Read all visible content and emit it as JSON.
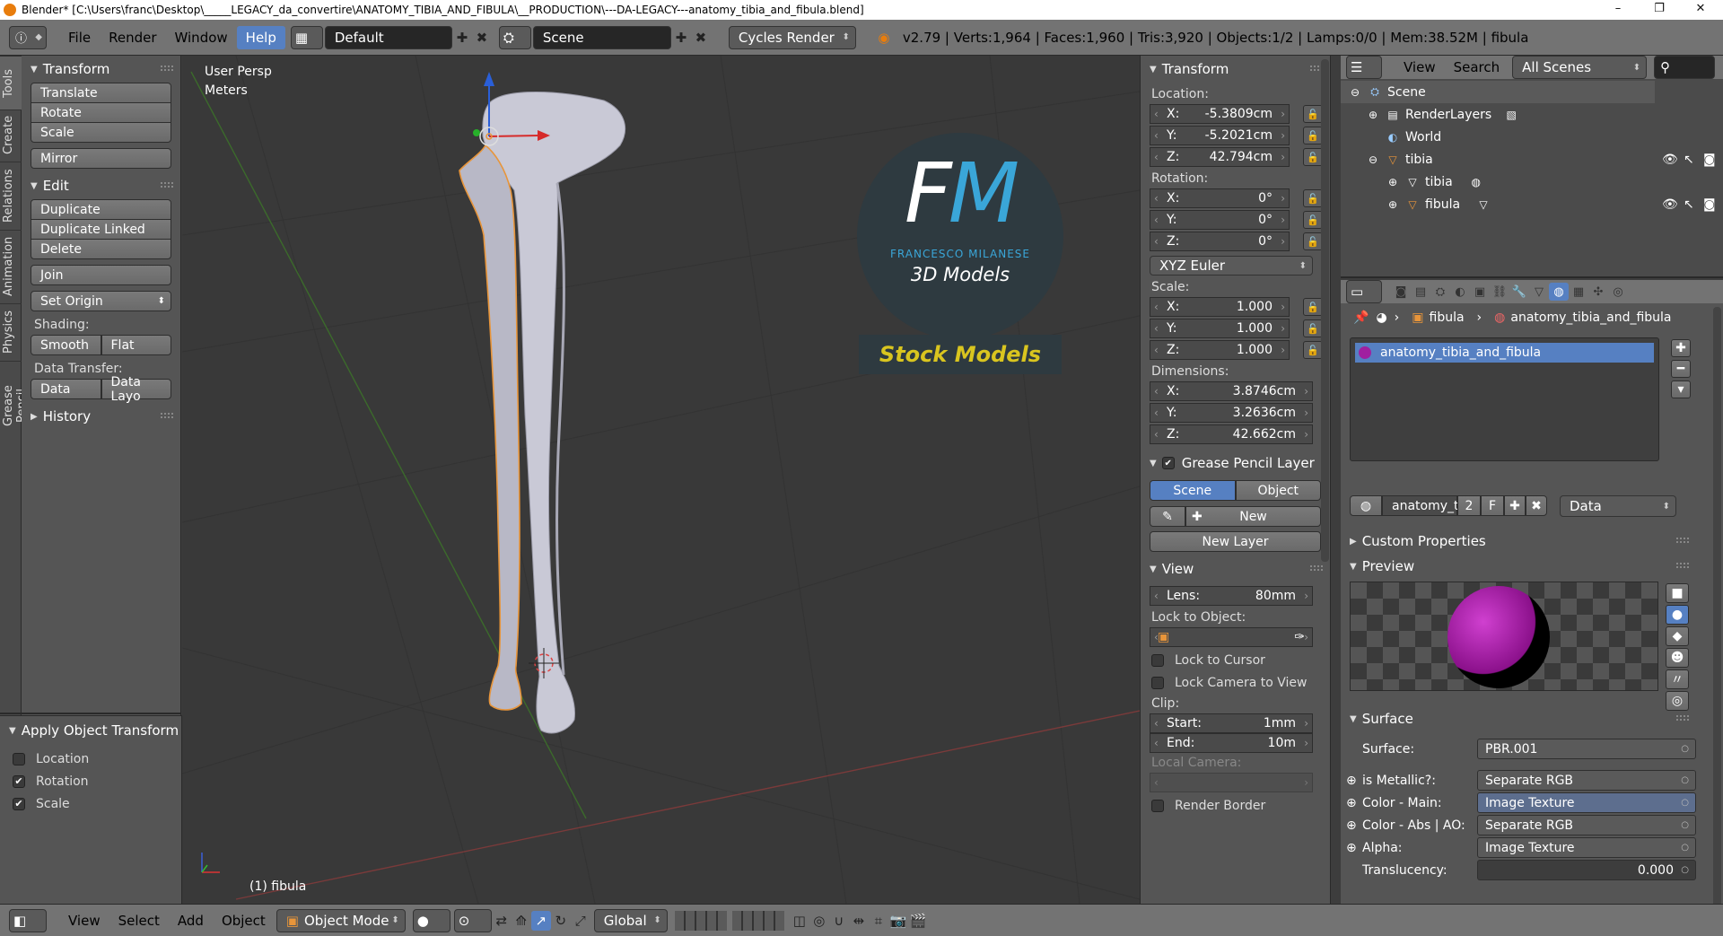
{
  "window": {
    "title": "Blender* [C:\\Users\\franc\\Desktop\\_____LEGACY_da_convertire\\ANATOMY_TIBIA_AND_FIBULA\\__PRODUCTION\\---DA-LEGACY---anatomy_tibia_and_fibula.blend]",
    "minimize": "–",
    "maximize": "❐",
    "close": "✕"
  },
  "topbar": {
    "menus": [
      "File",
      "Render",
      "Window",
      "Help"
    ],
    "active_menu": "Help",
    "layout": "Default",
    "scene": "Scene",
    "engine": "Cycles Render",
    "stats": "v2.79 | Verts:1,964 | Faces:1,960 | Tris:3,920 | Objects:1/2 | Lamps:0/0 | Mem:38.52M | fibula"
  },
  "tabs": [
    "Tools",
    "Create",
    "Relations",
    "Animation",
    "Physics",
    "Grease Pencil"
  ],
  "toolshelf": {
    "transform": {
      "title": "Transform",
      "buttons": [
        "Translate",
        "Rotate",
        "Scale"
      ],
      "mirror": "Mirror"
    },
    "edit": {
      "title": "Edit",
      "buttons": [
        "Duplicate",
        "Duplicate Linked",
        "Delete"
      ],
      "join": "Join",
      "set_origin": "Set Origin",
      "shading_label": "Shading:",
      "smooth": "Smooth",
      "flat": "Flat",
      "data_transfer_label": "Data Transfer:",
      "data": "Data",
      "data_layout": "Data Layo"
    },
    "history": "History",
    "apply": {
      "title": "Apply Object Transform",
      "location": "Location",
      "rotation": "Rotation",
      "scale": "Scale"
    }
  },
  "viewport": {
    "view_name": "User Persp",
    "units": "Meters",
    "object_label": "(1) fibula",
    "logo": {
      "letters": "FM",
      "name": "FRANCESCO MILANESE",
      "line2": "3D Models",
      "line3": "Stock Models"
    }
  },
  "npanel": {
    "transform_title": "Transform",
    "location_label": "Location:",
    "location": [
      {
        "k": "X:",
        "v": "-5.3809cm"
      },
      {
        "k": "Y:",
        "v": "-5.2021cm"
      },
      {
        "k": "Z:",
        "v": "42.794cm"
      }
    ],
    "rotation_label": "Rotation:",
    "rotation": [
      {
        "k": "X:",
        "v": "0°"
      },
      {
        "k": "Y:",
        "v": "0°"
      },
      {
        "k": "Z:",
        "v": "0°"
      }
    ],
    "rotation_mode": "XYZ Euler",
    "scale_label": "Scale:",
    "scale": [
      {
        "k": "X:",
        "v": "1.000"
      },
      {
        "k": "Y:",
        "v": "1.000"
      },
      {
        "k": "Z:",
        "v": "1.000"
      }
    ],
    "dimensions_label": "Dimensions:",
    "dimensions": [
      {
        "k": "X:",
        "v": "3.8746cm"
      },
      {
        "k": "Y:",
        "v": "3.2636cm"
      },
      {
        "k": "Z:",
        "v": "42.662cm"
      }
    ],
    "gp_title": "Grease Pencil Layer",
    "gp_scene": "Scene",
    "gp_object": "Object",
    "gp_new": "New",
    "gp_new_layer": "New Layer",
    "view_title": "View",
    "lens_k": "Lens:",
    "lens_v": "80mm",
    "lock_obj": "Lock to Object:",
    "lock_cursor": "Lock to Cursor",
    "lock_cam": "Lock Camera to View",
    "clip": "Clip:",
    "start_k": "Start:",
    "start_v": "1mm",
    "end_k": "End:",
    "end_v": "10m",
    "local_cam": "Local Camera:",
    "render_border": "Render Border"
  },
  "outliner": {
    "view": "View",
    "search": "Search",
    "scenes": "All Scenes",
    "rows": [
      {
        "label": "Scene",
        "indent": 0,
        "icon": "scene-icon"
      },
      {
        "label": "RenderLayers",
        "indent": 1,
        "icon": "renderlayers-icon"
      },
      {
        "label": "World",
        "indent": 1,
        "icon": "world-icon"
      },
      {
        "label": "tibia",
        "indent": 1,
        "icon": "mesh-icon"
      },
      {
        "label": "tibia",
        "indent": 2,
        "icon": "meshdata-icon"
      },
      {
        "label": "fibula",
        "indent": 2,
        "icon": "mesh-icon"
      }
    ]
  },
  "properties": {
    "breadcrumb_obj": "fibula",
    "breadcrumb_mat": "anatomy_tibia_and_fibula",
    "slot": "anatomy_tibia_and_fibula",
    "mat_field": "anatomy_t...",
    "users": "2",
    "fake": "F",
    "link": "Data",
    "custom_props": "Custom Properties",
    "preview": "Preview",
    "surface_title": "Surface",
    "rows": [
      {
        "k": "Surface:",
        "v": "PBR.001"
      },
      {
        "k": "is Metallic?:",
        "v": "Separate RGB"
      },
      {
        "k": "Color - Main:",
        "v": "Image Texture"
      },
      {
        "k": "Color - Abs | AO:",
        "v": "Separate RGB"
      },
      {
        "k": "Alpha:",
        "v": "Image Texture"
      },
      {
        "k": "Translucency:",
        "v": "0.000"
      }
    ]
  },
  "bottombar": {
    "view": "View",
    "select": "Select",
    "add": "Add",
    "object": "Object",
    "mode": "Object Mode",
    "orientation": "Global"
  },
  "colors": {
    "accent": "#5680c2",
    "header": "#737373",
    "panel": "#555555",
    "viewport": "#393939",
    "logo_blue": "#3aa6d8",
    "logo_yellow": "#d9c51f"
  }
}
